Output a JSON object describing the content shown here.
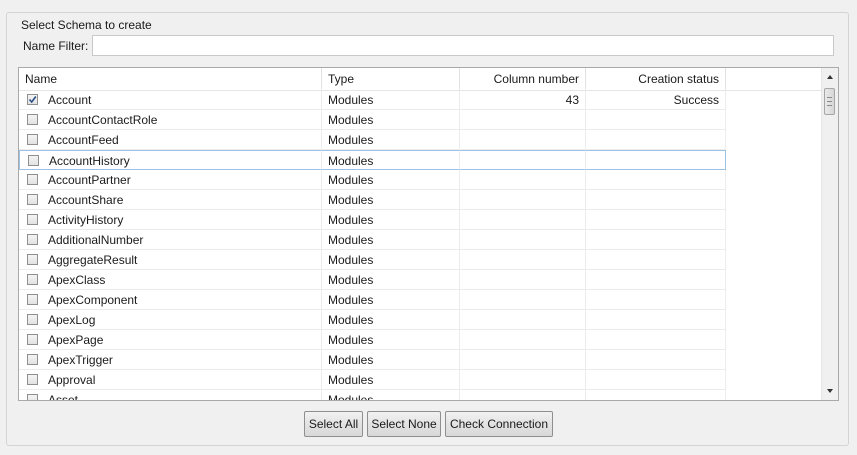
{
  "group": {
    "title": "Select Schema to create"
  },
  "filter": {
    "label": "Name Filter:",
    "value": "",
    "placeholder": ""
  },
  "table": {
    "columns": [
      "Name",
      "Type",
      "Column number",
      "Creation status"
    ],
    "rows": [
      {
        "name": "Account",
        "type": "Modules",
        "column_number": "43",
        "status": "Success",
        "checked": true
      },
      {
        "name": "AccountContactRole",
        "type": "Modules",
        "column_number": "",
        "status": "",
        "checked": false
      },
      {
        "name": "AccountFeed",
        "type": "Modules",
        "column_number": "",
        "status": "",
        "checked": false
      },
      {
        "name": "AccountHistory",
        "type": "Modules",
        "column_number": "",
        "status": "",
        "checked": false,
        "focused": true
      },
      {
        "name": "AccountPartner",
        "type": "Modules",
        "column_number": "",
        "status": "",
        "checked": false
      },
      {
        "name": "AccountShare",
        "type": "Modules",
        "column_number": "",
        "status": "",
        "checked": false
      },
      {
        "name": "ActivityHistory",
        "type": "Modules",
        "column_number": "",
        "status": "",
        "checked": false
      },
      {
        "name": "AdditionalNumber",
        "type": "Modules",
        "column_number": "",
        "status": "",
        "checked": false
      },
      {
        "name": "AggregateResult",
        "type": "Modules",
        "column_number": "",
        "status": "",
        "checked": false
      },
      {
        "name": "ApexClass",
        "type": "Modules",
        "column_number": "",
        "status": "",
        "checked": false
      },
      {
        "name": "ApexComponent",
        "type": "Modules",
        "column_number": "",
        "status": "",
        "checked": false
      },
      {
        "name": "ApexLog",
        "type": "Modules",
        "column_number": "",
        "status": "",
        "checked": false
      },
      {
        "name": "ApexPage",
        "type": "Modules",
        "column_number": "",
        "status": "",
        "checked": false
      },
      {
        "name": "ApexTrigger",
        "type": "Modules",
        "column_number": "",
        "status": "",
        "checked": false
      },
      {
        "name": "Approval",
        "type": "Modules",
        "column_number": "",
        "status": "",
        "checked": false
      },
      {
        "name": "Asset",
        "type": "Modules",
        "column_number": "",
        "status": "",
        "checked": false
      }
    ]
  },
  "buttons": {
    "select_all": "Select All",
    "select_none": "Select None",
    "check_connection": "Check Connection"
  },
  "colors": {
    "check": "#2b4f8a",
    "focus_border": "#9cc3e6"
  }
}
